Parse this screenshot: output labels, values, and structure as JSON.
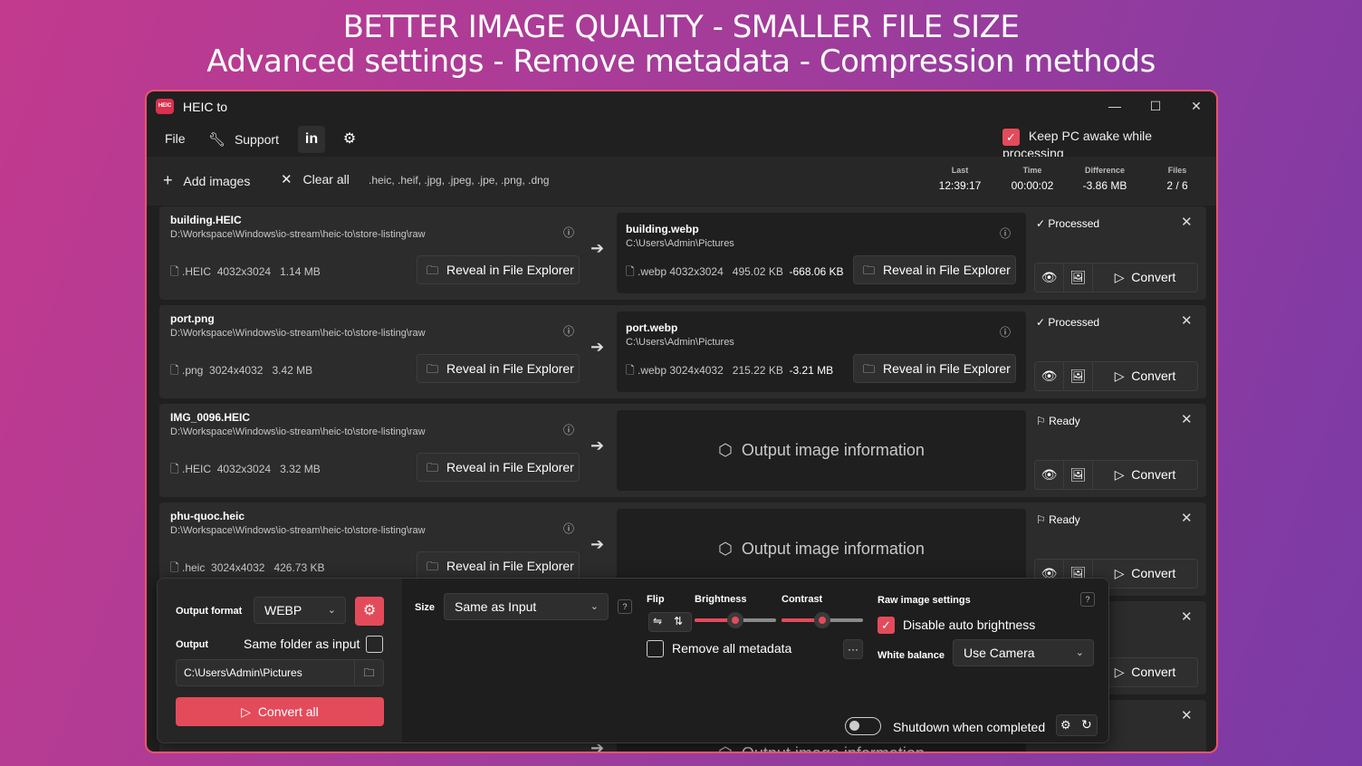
{
  "banner": {
    "line1": "BETTER IMAGE QUALITY - SMALLER FILE SIZE",
    "line2": "Advanced settings - Remove metadata - Compression methods"
  },
  "app": {
    "logo_text": "HEIC",
    "title": "HEIC to",
    "window_controls": {
      "minimize": "—",
      "maximize": "☐",
      "close": "✕"
    }
  },
  "menu": {
    "file": "File",
    "support": "Support",
    "linkedin": "in",
    "keep_awake_label": "Keep PC awake while processing",
    "keep_awake_checked": true
  },
  "toolbar": {
    "add_images": "Add images",
    "clear_all": "Clear all",
    "formats": ".heic, .heif, .jpg, .jpeg, .jpe, .png, .dng",
    "stats": [
      {
        "label": "Last",
        "value": "12:39:17"
      },
      {
        "label": "Time",
        "value": "00:00:02"
      },
      {
        "label": "Difference",
        "value": "-3.86 MB"
      },
      {
        "label": "Files",
        "value": "2 / 6"
      }
    ]
  },
  "files": [
    {
      "name": "building.HEIC",
      "path": "D:\\Workspace\\Windows\\io-stream\\heic-to\\store-listing\\raw",
      "ext": ".HEIC",
      "dims": "4032x3024",
      "size": "1.14 MB",
      "reveal": "Reveal in File Explorer",
      "output": {
        "name": "building.webp",
        "path": "C:\\Users\\Admin\\Pictures",
        "ext": ".webp",
        "dims": "4032x3024",
        "size": "495.02 KB",
        "diff": "-668.06 KB",
        "reveal": "Reveal in File Explorer"
      },
      "status": "Processed",
      "convert": "Convert"
    },
    {
      "name": "port.png",
      "path": "D:\\Workspace\\Windows\\io-stream\\heic-to\\store-listing\\raw",
      "ext": ".png",
      "dims": "3024x4032",
      "size": "3.42 MB",
      "reveal": "Reveal in File Explorer",
      "output": {
        "name": "port.webp",
        "path": "C:\\Users\\Admin\\Pictures",
        "ext": ".webp",
        "dims": "3024x4032",
        "size": "215.22 KB",
        "diff": "-3.21 MB",
        "reveal": "Reveal in File Explorer"
      },
      "status": "Processed",
      "convert": "Convert"
    },
    {
      "name": "IMG_0096.HEIC",
      "path": "D:\\Workspace\\Windows\\io-stream\\heic-to\\store-listing\\raw",
      "ext": ".HEIC",
      "dims": "4032x3024",
      "size": "3.32 MB",
      "reveal": "Reveal in File Explorer",
      "output_placeholder": "Output image information",
      "status": "Ready",
      "convert": "Convert"
    },
    {
      "name": "phu-quoc.heic",
      "path": "D:\\Workspace\\Windows\\io-stream\\heic-to\\store-listing\\raw",
      "ext": ".heic",
      "dims": "3024x4032",
      "size": "426.73 KB",
      "reveal": "Reveal in File Explorer",
      "output_placeholder": "Output image information",
      "status": "Ready",
      "convert": "Convert"
    }
  ],
  "partial_rows": {
    "convert": "Convert",
    "output_placeholder": "Output image information"
  },
  "settings": {
    "output_format_label": "Output format",
    "output_format": "WEBP",
    "output_label": "Output",
    "same_folder_label": "Same folder as input",
    "output_path": "C:\\Users\\Admin\\Pictures",
    "convert_all": "Convert all",
    "size_label": "Size",
    "size_value": "Same as Input",
    "help": "?",
    "flip_label": "Flip",
    "brightness_label": "Brightness",
    "brightness_level": 0.5,
    "contrast_label": "Contrast",
    "contrast_level": 0.5,
    "remove_metadata_label": "Remove all metadata",
    "more": "···",
    "raw_label": "Raw image settings",
    "disable_auto_brightness": "Disable auto brightness",
    "white_balance_label": "White balance",
    "white_balance_value": "Use Camera",
    "shutdown_label": "Shutdown when completed"
  },
  "colors": {
    "accent": "#e34b5b",
    "window_bg": "#202020"
  }
}
